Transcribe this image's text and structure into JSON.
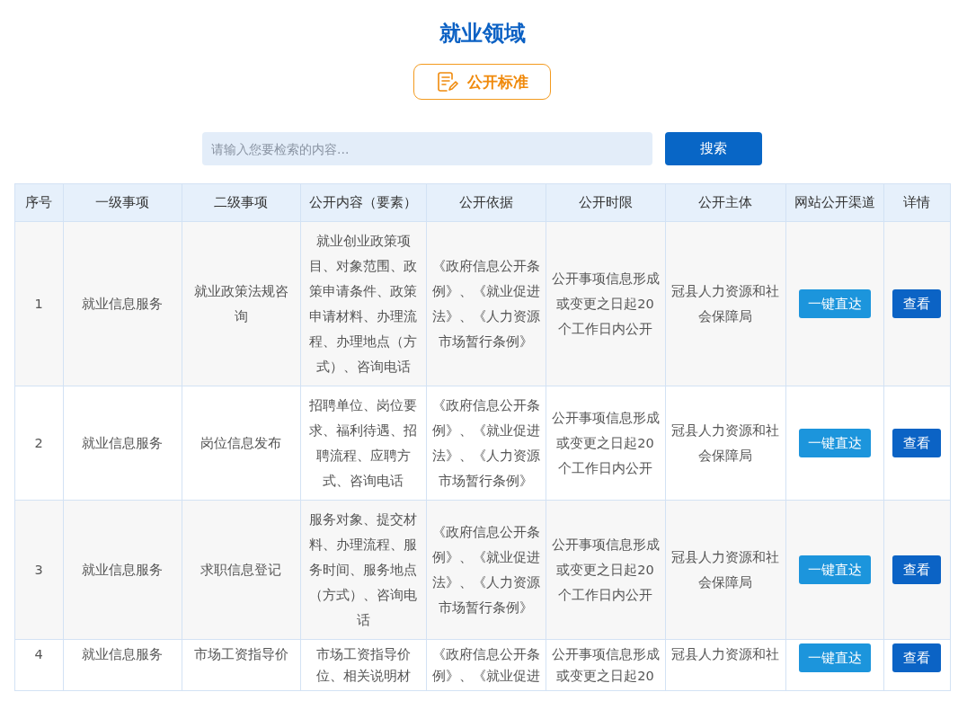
{
  "title": "就业领域",
  "standard_button": {
    "label": "公开标准"
  },
  "search": {
    "placeholder": "请输入您要检索的内容...",
    "button": "搜索"
  },
  "table": {
    "columns": [
      "序号",
      "一级事项",
      "二级事项",
      "公开内容（要素）",
      "公开依据",
      "公开时限",
      "公开主体",
      "网站公开渠道",
      "详情"
    ],
    "rows": [
      {
        "index": "1",
        "level1": "就业信息服务",
        "level2": "就业政策法规咨询",
        "content": "就业创业政策项目、对象范围、政策申请条件、政策申请材料、办理流程、办理地点（方式）、咨询电话",
        "basis": "《政府信息公开条例》、《就业促进法》、《人力资源市场暂行条例》",
        "time_limit": "公开事项信息形成或变更之日起20个工作日内公开",
        "subject": "冠县人力资源和社会保障局",
        "channel_button": "一键直达",
        "detail_button": "查看"
      },
      {
        "index": "2",
        "level1": "就业信息服务",
        "level2": "岗位信息发布",
        "content": "招聘单位、岗位要求、福利待遇、招聘流程、应聘方式、咨询电话",
        "basis": "《政府信息公开条例》、《就业促进法》、《人力资源市场暂行条例》",
        "time_limit": "公开事项信息形成或变更之日起20个工作日内公开",
        "subject": "冠县人力资源和社会保障局",
        "channel_button": "一键直达",
        "detail_button": "查看"
      },
      {
        "index": "3",
        "level1": "就业信息服务",
        "level2": "求职信息登记",
        "content": "服务对象、提交材料、办理流程、服务时间、服务地点（方式）、咨询电话",
        "basis": "《政府信息公开条例》、《就业促进法》、《人力资源市场暂行条例》",
        "time_limit": "公开事项信息形成或变更之日起20个工作日内公开",
        "subject": "冠县人力资源和社会保障局",
        "channel_button": "一键直达",
        "detail_button": "查看"
      },
      {
        "index": "4",
        "level1": "就业信息服务",
        "level2": "市场工资指导价",
        "content": "市场工资指导价位、相关说明材",
        "basis": "《政府信息公开条例》、《就业促进",
        "time_limit": "公开事项信息形成或变更之日起20",
        "subject": "冠县人力资源和社",
        "channel_button": "一键直达",
        "detail_button": "查看"
      }
    ]
  }
}
